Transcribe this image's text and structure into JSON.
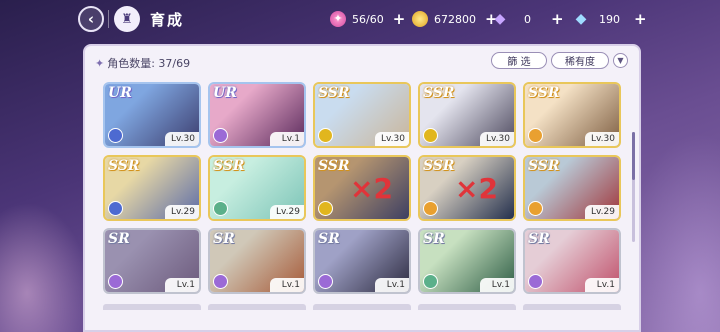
{
  "header": {
    "title": "育成",
    "back_icon": "chevron-left",
    "home_icon": "castle"
  },
  "resources": [
    {
      "name": "candy",
      "value": "56/60"
    },
    {
      "name": "coin",
      "value": "672800"
    },
    {
      "name": "gem-purple",
      "value": "0"
    },
    {
      "name": "gem-blue",
      "value": "190"
    }
  ],
  "panel": {
    "count_label": "角色数量: 37/69",
    "filter_label": "篩 选",
    "rarity_label": "稀有度",
    "sort_icon": "chevron-down"
  },
  "cards": [
    {
      "rarity": "UR",
      "level": "Lv.30",
      "attr_color": "#4d6ad1",
      "bg": [
        "#7fa6e0",
        "#3c3d6e"
      ],
      "dup": ""
    },
    {
      "rarity": "UR",
      "level": "Lv.1",
      "attr_color": "#9b6ad6",
      "bg": [
        "#e7a9c9",
        "#5a2a5c"
      ],
      "dup": ""
    },
    {
      "rarity": "SSR",
      "level": "Lv.30",
      "attr_color": "#e1b61e",
      "bg": [
        "#c9dcef",
        "#c9b59a"
      ],
      "dup": ""
    },
    {
      "rarity": "SSR",
      "level": "Lv.30",
      "attr_color": "#e1b61e",
      "bg": [
        "#e4e4ee",
        "#4e4a5f"
      ],
      "dup": ""
    },
    {
      "rarity": "SSR",
      "level": "Lv.30",
      "attr_color": "#e9a030",
      "bg": [
        "#f4e1c5",
        "#7e5e42"
      ],
      "dup": ""
    },
    {
      "rarity": "SSR",
      "level": "Lv.29",
      "attr_color": "#4d6ad1",
      "bg": [
        "#e7d8a5",
        "#5b6ba8"
      ],
      "dup": ""
    },
    {
      "rarity": "SSR",
      "level": "Lv.29",
      "attr_color": "#5bb08a",
      "bg": [
        "#c7eee0",
        "#7cc4b7"
      ],
      "dup": ""
    },
    {
      "rarity": "SSR",
      "level": "",
      "attr_color": "#e1b61e",
      "bg": [
        "#b59570",
        "#3d3f62"
      ],
      "dup": "×2"
    },
    {
      "rarity": "SSR",
      "level": "",
      "attr_color": "#e9a030",
      "bg": [
        "#d8d0c2",
        "#24304d"
      ],
      "dup": "×2"
    },
    {
      "rarity": "SSR",
      "level": "Lv.29",
      "attr_color": "#e9a030",
      "bg": [
        "#b9c9d6",
        "#a0353a"
      ],
      "dup": ""
    },
    {
      "rarity": "SR",
      "level": "Lv.1",
      "attr_color": "#9b6ad6",
      "bg": [
        "#9a91b0",
        "#6c5a7c"
      ],
      "dup": ""
    },
    {
      "rarity": "SR",
      "level": "Lv.1",
      "attr_color": "#9b6ad6",
      "bg": [
        "#d0c8b8",
        "#a65a38"
      ],
      "dup": ""
    },
    {
      "rarity": "SR",
      "level": "Lv.1",
      "attr_color": "#9b6ad6",
      "bg": [
        "#9fa1c6",
        "#2d2b40"
      ],
      "dup": ""
    },
    {
      "rarity": "SR",
      "level": "Lv.1",
      "attr_color": "#5bb08a",
      "bg": [
        "#c7e0c0",
        "#2e5d45"
      ],
      "dup": ""
    },
    {
      "rarity": "SR",
      "level": "Lv.1",
      "attr_color": "#9b6ad6",
      "bg": [
        "#e5cdd6",
        "#c0506a"
      ],
      "dup": ""
    }
  ]
}
